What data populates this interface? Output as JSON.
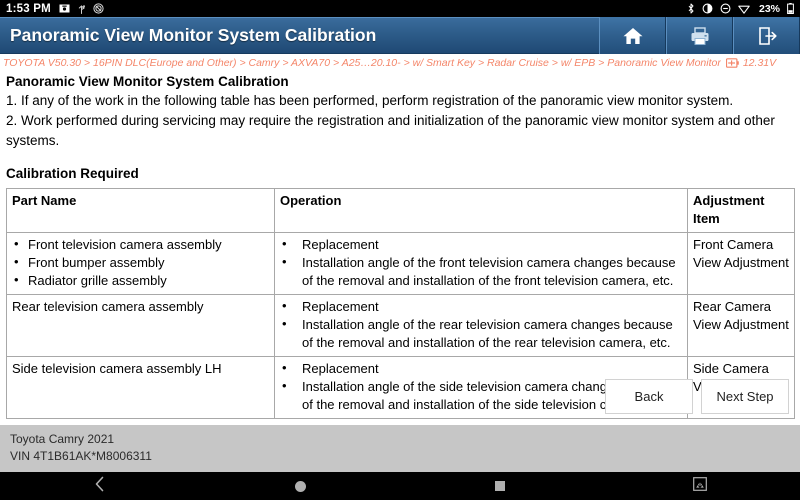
{
  "status_bar": {
    "clock": "1:53 PM",
    "battery_percent": "23%",
    "left_icons": [
      "screenshot-icon",
      "usb-icon",
      "do-not-disturb-icon"
    ],
    "right_icons": [
      "bluetooth-icon",
      "brightness-icon",
      "mute-icon",
      "wifi-icon",
      "battery-icon"
    ]
  },
  "title_bar": {
    "title": "Panoramic View Monitor System Calibration",
    "buttons": [
      {
        "name": "home-button",
        "icon": "home-icon"
      },
      {
        "name": "print-button",
        "icon": "printer-icon"
      },
      {
        "name": "exit-button",
        "icon": "exit-icon"
      }
    ]
  },
  "breadcrumb": {
    "path": "TOYOTA V50.30 > 16PIN DLC(Europe and Other) > Camry > AXVA70 > A25…20.10- > w/ Smart Key > Radar Cruise > w/ EPB > Panoramic View Monitor",
    "battery_icon": "battery-icon",
    "voltage": "12.31V",
    "color": "#f4866a"
  },
  "main": {
    "heading": "Panoramic View Monitor System Calibration",
    "paragraphs": [
      "1. If any of the work in the following table has been performed, perform registration of the panoramic view monitor system.",
      "2. Work performed during servicing may require the registration and initialization of the panoramic view monitor system and other systems."
    ],
    "table_caption": "Calibration Required",
    "table": {
      "headers": [
        "Part Name",
        "Operation",
        "Adjustment Item"
      ],
      "rows": [
        {
          "part_items": [
            "Front television camera assembly",
            "Front bumper assembly",
            "Radiator grille assembly"
          ],
          "operation_items": [
            "Replacement",
            "Installation angle of the front television camera changes because of the removal and installation of the front television camera, etc."
          ],
          "adjustment": "Front Camera View Adjustment"
        },
        {
          "part_plain": "Rear television camera assembly",
          "operation_items": [
            "Replacement",
            "Installation angle of the rear television camera changes because of the removal and installation of the rear television camera, etc."
          ],
          "adjustment": "Rear Camera View Adjustment"
        },
        {
          "part_plain": "Side television camera assembly LH",
          "operation_items": [
            "Replacement",
            "Installation angle of the side television camera changes because of the removal and installation of the side television camera, etc."
          ],
          "adjustment": "Side Camera View Adjustment"
        }
      ]
    }
  },
  "dialog_buttons": {
    "back": "Back",
    "next": "Next Step"
  },
  "footer": {
    "vehicle": "Toyota Camry 2021",
    "vin": "VIN 4T1B61AK*M8006311"
  },
  "nav_bar": {
    "items": [
      {
        "name": "nav-back-button",
        "icon": "chevron-left-icon"
      },
      {
        "name": "nav-home-button",
        "icon": "circle-icon"
      },
      {
        "name": "nav-recents-button",
        "icon": "square-icon"
      },
      {
        "name": "nav-screenshot-button",
        "icon": "screenshot-icon"
      }
    ]
  }
}
